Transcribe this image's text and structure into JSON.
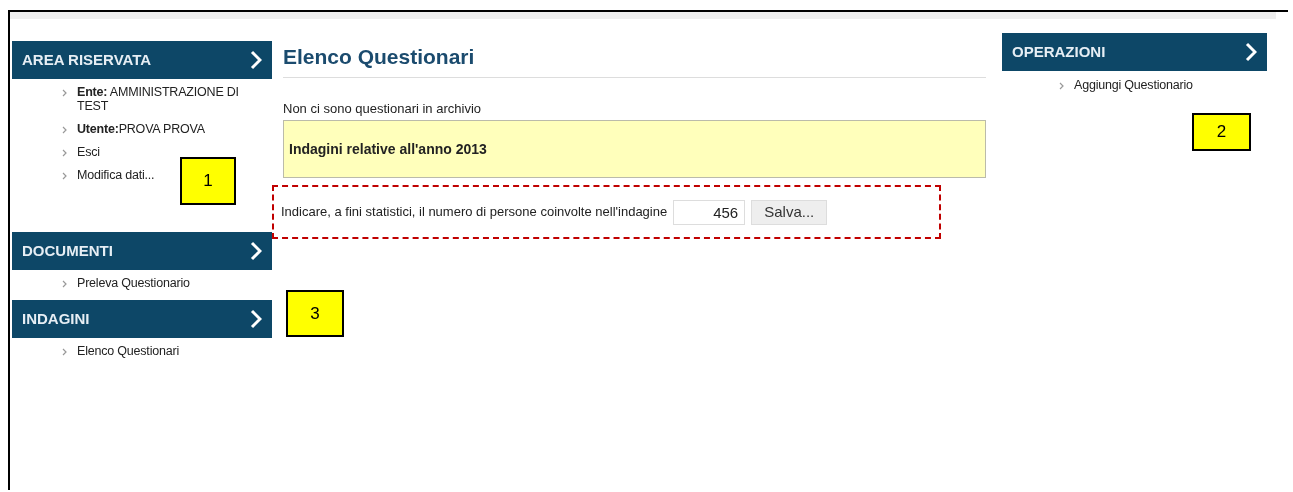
{
  "left_sidebar": [
    {
      "heading": "AREA RISERVATA",
      "items": [
        "**Ente:** AMMINISTRAZIONE DI TEST",
        "**Utente:**PROVA PROVA",
        "Esci",
        "Modifica dati..."
      ]
    },
    {
      "heading": "DOCUMENTI",
      "items": [
        "Preleva Questionario"
      ]
    },
    {
      "heading": "INDAGINI",
      "items": [
        "Elenco Questionari"
      ]
    }
  ],
  "main": {
    "title": "Elenco Questionari",
    "message": "Non ci sono questionari in archivio",
    "notice": "Indagini relative all'anno 2013",
    "field_label": "Indicare, a fini statistici, il numero di persone coinvolte nell'indagine",
    "field_value": "456",
    "button": "Salva..."
  },
  "right_sidebar": {
    "heading": "OPERAZIONI",
    "items": [
      "Aggiungi Questionario"
    ]
  },
  "callouts": [
    "1",
    "2",
    "3"
  ]
}
